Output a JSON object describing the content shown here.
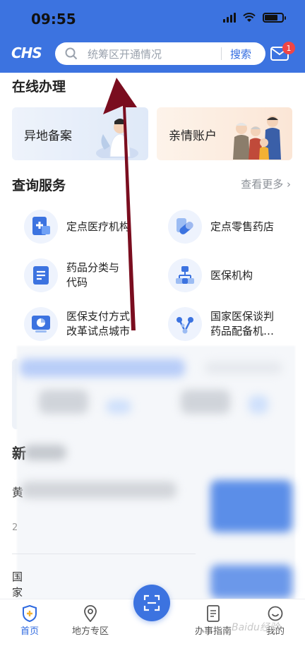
{
  "status_bar": {
    "time": "09:55"
  },
  "header": {
    "logo": "CHS",
    "search_placeholder": "统筹区开通情况",
    "search_button": "搜索",
    "notification_count": "1"
  },
  "online": {
    "title": "在线办理",
    "cards": [
      {
        "label": "异地备案"
      },
      {
        "label": "亲情账户"
      }
    ]
  },
  "query": {
    "title": "查询服务",
    "more": "查看更多 ›",
    "services": [
      {
        "label": "定点医疗机构",
        "icon": "hospital-icon"
      },
      {
        "label": "定点零售药店",
        "icon": "pill-icon"
      },
      {
        "label": "药品分类与\n代码",
        "icon": "document-icon"
      },
      {
        "label": "医保机构",
        "icon": "org-icon"
      },
      {
        "label": "医保支付方式\n改革试点城市",
        "icon": "pie-chart-icon"
      },
      {
        "label": "国家医保谈判\n药品配备机…",
        "icon": "network-icon"
      }
    ]
  },
  "blurred_section": {
    "title_fragment": "新",
    "row1_fragment": "黄",
    "row2_fragment": "2",
    "row3_fragment": "国\n家"
  },
  "tabbar": {
    "tabs": [
      {
        "label": "首页",
        "active": true
      },
      {
        "label": "地方专区",
        "active": false
      },
      {
        "label": "办事指南",
        "active": false
      },
      {
        "label": "我的",
        "active": false
      }
    ]
  },
  "watermark": "Baidu经验",
  "colors": {
    "brand": "#3c73e0",
    "arrow": "#7a0d1f",
    "badge": "#f04545"
  }
}
